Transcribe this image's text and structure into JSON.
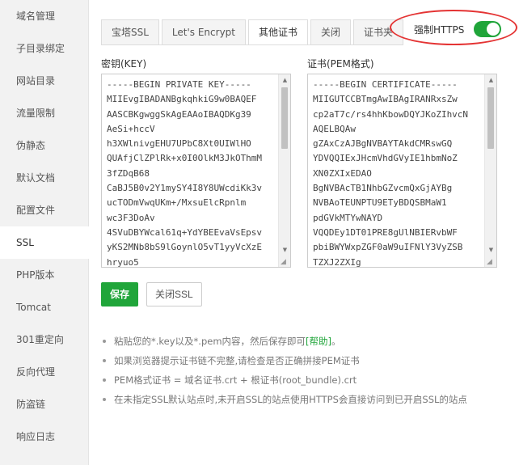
{
  "sidebar": {
    "items": [
      {
        "label": "域名管理",
        "active": false
      },
      {
        "label": "子目录绑定",
        "active": false
      },
      {
        "label": "网站目录",
        "active": false
      },
      {
        "label": "流量限制",
        "active": false
      },
      {
        "label": "伪静态",
        "active": false
      },
      {
        "label": "默认文档",
        "active": false
      },
      {
        "label": "配置文件",
        "active": false
      },
      {
        "label": "SSL",
        "active": true
      },
      {
        "label": "PHP版本",
        "active": false
      },
      {
        "label": "Tomcat",
        "active": false
      },
      {
        "label": "301重定向",
        "active": false
      },
      {
        "label": "反向代理",
        "active": false
      },
      {
        "label": "防盗链",
        "active": false
      },
      {
        "label": "响应日志",
        "active": false
      }
    ]
  },
  "tabs": [
    {
      "label": "宝塔SSL",
      "active": false
    },
    {
      "label": "Let's Encrypt",
      "active": false
    },
    {
      "label": "其他证书",
      "active": true
    },
    {
      "label": "关闭",
      "active": false
    },
    {
      "label": "证书夹",
      "active": false
    }
  ],
  "force_https": {
    "label": "强制HTTPS",
    "enabled": true
  },
  "key_field": {
    "label": "密钥(KEY)",
    "lines": [
      "-----BEGIN PRIVATE KEY-----",
      "MIIEvgIBADANBgkqhkiG9w0BAQEF",
      "AASCBKgwggSkAgEAAoIBAQDKg39",
      "AeSi+hccV",
      "h3XWlnivgEHU7UPbC8Xt0UIWlHO",
      "QUAfjClZPlRk+x0I0OlkM3JkOThmM",
      "3fZDqB68",
      "CaBJ5B0v2Y1mySY4I8Y8UWcdiKk3v",
      "ucTODmVwqUKm+/MxsuElcRpnlm",
      "wc3F3DoAv",
      "4SVuDBYWcal61q+YdYBEEvaVsEpsv",
      "yKS2MNb8bS9lGoynlO5vT1yyVcXzE",
      "hryuo5"
    ]
  },
  "cert_field": {
    "label": "证书(PEM格式)",
    "lines": [
      "-----BEGIN CERTIFICATE-----",
      "MIIGUTCCBTmgAwIBAgIRANRxsZw",
      "cp2aT7c/rs4hhKbowDQYJKoZIhvcN",
      "AQELBQAw",
      "gZAxCzAJBgNVBAYTAkdCMRswGQ",
      "YDVQQIExJHcmVhdGVyIE1hbmNoZ",
      "XN0ZXIxEDAO",
      "BgNVBAcTB1NhbGZvcmQxGjAYBg",
      "NVBAoTEUNPTU9ETyBDQSBMaW1",
      "pdGVkMTYwNAYD",
      "VQQDEy1DT01PRE8gUlNBIERvbWF",
      "pbiBWYWxpZGF0aW9uIFNlY3VyZSB",
      "TZXJ2ZXIg"
    ]
  },
  "buttons": {
    "save": "保存",
    "close_ssl": "关闭SSL"
  },
  "tips": [
    {
      "text": "粘贴您的*.key以及*.pem内容，然后保存即可",
      "link": "[帮助]",
      "suffix": "。"
    },
    {
      "text": "如果浏览器提示证书链不完整,请检查是否正确拼接PEM证书",
      "link": "",
      "suffix": ""
    },
    {
      "text": "PEM格式证书 = 域名证书.crt + 根证书(root_bundle).crt",
      "link": "",
      "suffix": ""
    },
    {
      "text": "在未指定SSL默认站点时,未开启SSL的站点使用HTTPS会直接访问到已开启SSL的站点",
      "link": "",
      "suffix": ""
    }
  ],
  "colors": {
    "accent": "#20a53a",
    "highlight": "#e43434"
  }
}
